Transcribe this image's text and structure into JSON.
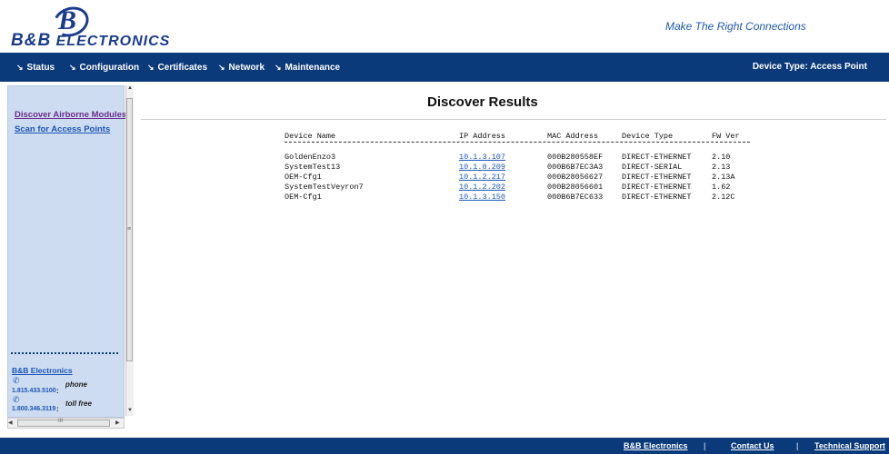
{
  "header": {
    "logo_main": "B&B",
    "logo_rest": "Electronics",
    "logo_mark": "B",
    "tagline": "Make The Right Connections"
  },
  "nav": {
    "items": [
      {
        "label": "Status"
      },
      {
        "label": "Configuration"
      },
      {
        "label": "Certificates"
      },
      {
        "label": "Network"
      },
      {
        "label": "Maintenance"
      }
    ],
    "arrow_glyph": "↘",
    "device_type": "Device Type: Access Point"
  },
  "sidebar": {
    "links": [
      {
        "label": "Discover Airborne Modules"
      },
      {
        "label": "Scan for Access Points"
      }
    ],
    "company_link": "B&B Electronics",
    "phones": [
      {
        "number": "1.815.433.5100",
        "label": "phone"
      },
      {
        "number": "1.800.346.3119",
        "label": "toll free"
      }
    ],
    "colon": ":",
    "scroll_grip": "≡",
    "hscroll_grip": "III"
  },
  "main": {
    "title": "Discover Results",
    "columns": [
      "Device Name",
      "IP Address",
      "MAC Address",
      "Device Type",
      "FW Ver"
    ],
    "rows": [
      {
        "name": "GoldenEnzo3",
        "ip": "10.1.3.107",
        "mac": "000B280558EF",
        "type": "DIRECT-ETHERNET",
        "fw": "2.10"
      },
      {
        "name": "SystemTest13",
        "ip": "10.1.0.209",
        "mac": "000B6B7EC3A3",
        "type": "DIRECT-SERIAL",
        "fw": "2.13"
      },
      {
        "name": "OEM-Cfg1",
        "ip": "10.1.2.217",
        "mac": "000B28056627",
        "type": "DIRECT-ETHERNET",
        "fw": "2.13A"
      },
      {
        "name": "SystemTestVeyron7",
        "ip": "10.1.2.202",
        "mac": "000B28056601",
        "type": "DIRECT-ETHERNET",
        "fw": "1.62"
      },
      {
        "name": "OEM-Cfg1",
        "ip": "10.1.3.150",
        "mac": "000B6B7EC633",
        "type": "DIRECT-ETHERNET",
        "fw": "2.12C"
      }
    ]
  },
  "footer": {
    "links": [
      "B&B Electronics",
      "Contact Us",
      "Technical Support"
    ],
    "separator": "|"
  },
  "colors": {
    "nav_bg": "#0b3a7a",
    "sidebar_bg": "#cddcf0",
    "link_blue": "#1a56b8",
    "visited_purple": "#6b2e8c"
  }
}
